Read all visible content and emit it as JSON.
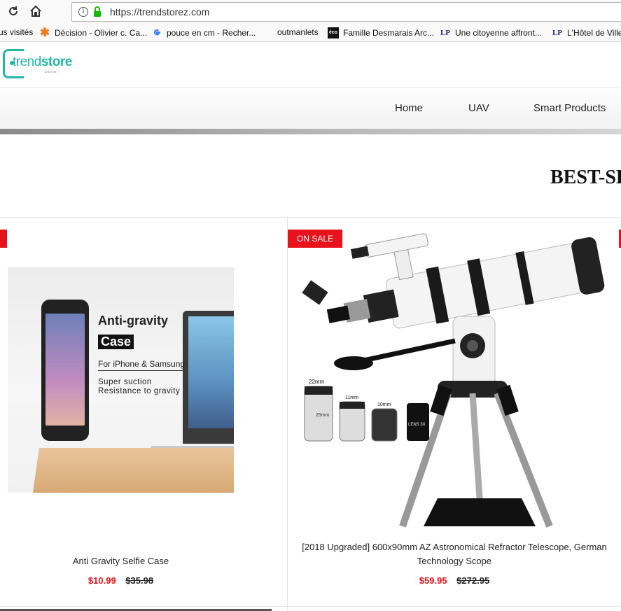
{
  "browser": {
    "url": "https://trendstorez.com",
    "bookmarks": [
      {
        "label": "us visités",
        "icon": "folder-icon"
      },
      {
        "label": "Décision - Olivier c. Ca...",
        "icon": "asterisk-icon",
        "color": "#f07a1a"
      },
      {
        "label": "pouce en cm - Recher...",
        "icon": "google-icon"
      },
      {
        "label": "outmanlets",
        "icon": "blank-icon"
      },
      {
        "label": "Famille Desmarais Arc...",
        "icon": "eco-icon",
        "icon_text": "éco"
      },
      {
        "label": "Une citoyenne affront...",
        "icon": "lp-icon",
        "icon_text": "LP"
      },
      {
        "label": "L'Hôtel de Ville",
        "icon": "lp-icon",
        "icon_text": "LP"
      }
    ]
  },
  "site": {
    "logo_prefix": "trend",
    "logo_bold": "store",
    "logo_tagline": "online life",
    "brand_color": "#1fb8a8",
    "nav": [
      "Home",
      "UAV",
      "Smart Products"
    ]
  },
  "section": {
    "title": "BEST-SE"
  },
  "products": [
    {
      "badge": "",
      "title": "Anti Gravity Selfie Case",
      "price": "$10.99",
      "old_price": "$35.98",
      "image_text": {
        "line1": "Anti-gravity",
        "line2": "Case",
        "line3": "For iPhone & Samsung",
        "line4": "Super suction",
        "line5": "Resistance to gravity"
      }
    },
    {
      "badge": "ON SALE",
      "title_line1": "[2018 Upgraded] 600x90mm AZ Astronomical Refractor Telescope, German",
      "title_line2": "Technology Scope",
      "price": "$59.95",
      "old_price": "$272.95",
      "image_text": {
        "e1": "22mm",
        "e2": "11mm",
        "e3": "10mm",
        "e4": "25mm",
        "e5": "LENS 3X"
      }
    }
  ],
  "colors": {
    "sale_red": "#e8121c"
  }
}
